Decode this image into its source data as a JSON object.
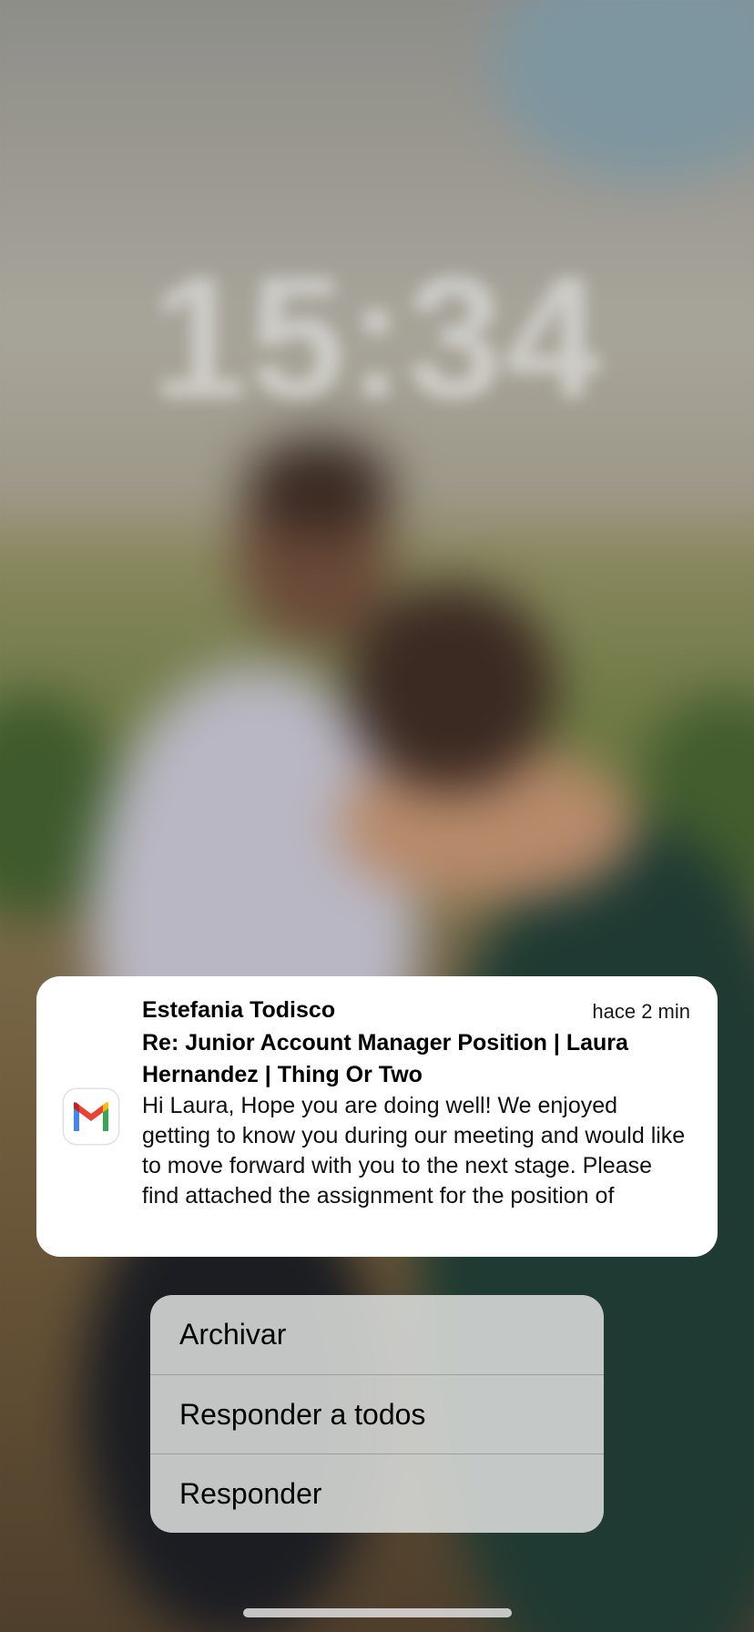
{
  "lock_screen": {
    "date": "",
    "time": "15:34"
  },
  "notification": {
    "app_icon": "gmail-icon",
    "sender": "Estefania Todisco",
    "timestamp": "hace 2 min",
    "subject": "Re: Junior Account Manager Position | Laura Hernandez | Thing Or Two",
    "preview": "Hi Laura, Hope you are doing well! We enjoyed getting to know you during our meeting and would like to move forward with you to the next stage. Please find attached the assignment for the position of"
  },
  "actions": [
    {
      "label": "Archivar"
    },
    {
      "label": "Responder a todos"
    },
    {
      "label": "Responder"
    }
  ],
  "colors": {
    "gmail_red": "#EA4335",
    "gmail_blue": "#4285F4",
    "gmail_green": "#34A853",
    "gmail_yellow": "#FBBC04",
    "gmail_darkred": "#C5221F"
  }
}
